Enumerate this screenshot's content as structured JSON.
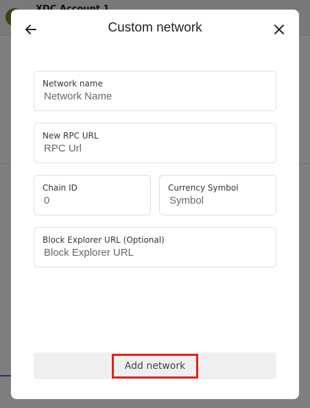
{
  "background": {
    "account_name": "XDC Account 1"
  },
  "modal": {
    "title": "Custom network",
    "back_icon": "arrow-left-icon",
    "close_icon": "close-icon",
    "fields": {
      "network_name": {
        "label": "Network name",
        "placeholder": "Network Name",
        "value": ""
      },
      "rpc_url": {
        "label": "New RPC URL",
        "placeholder": "RPC Url",
        "value": ""
      },
      "chain_id": {
        "label": "Chain ID",
        "placeholder": "0",
        "value": ""
      },
      "currency_symbol": {
        "label": "Currency Symbol",
        "placeholder": "Symbol",
        "value": ""
      },
      "block_explorer": {
        "label": "Block Explorer URL (Optional)",
        "placeholder": "Block Explorer URL",
        "value": ""
      }
    },
    "add_button_label": "Add network",
    "highlight_color": "#e0211c"
  }
}
